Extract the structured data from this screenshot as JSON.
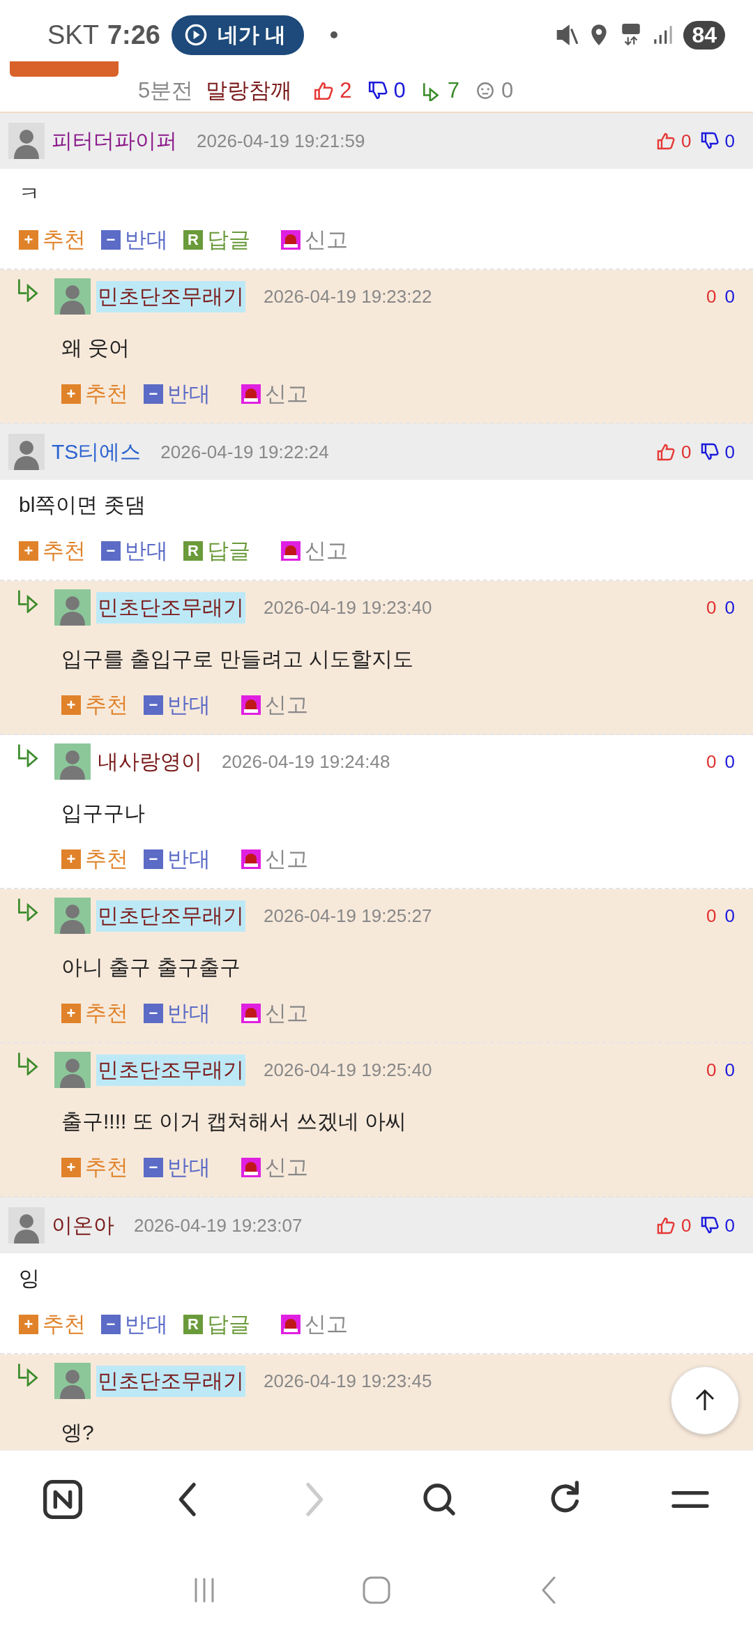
{
  "status_bar": {
    "carrier": "SKT",
    "time": "7:26",
    "media": "네가 내",
    "battery": "84"
  },
  "post_meta": {
    "ago": "5분전",
    "author": "말랑참깨",
    "likes": "2",
    "dislikes": "0",
    "replies": "7",
    "reactions": "0"
  },
  "comments": [
    {
      "kind": "comment",
      "name": "피터더파이퍼",
      "color": "#8b1a8b",
      "op": false,
      "highlighted": false,
      "time": "2026-04-19 19:21:59",
      "likes": "0",
      "dislikes": "0",
      "text": "ㅋ",
      "actions": [
        {
          "kind": "up",
          "label": "추천",
          "badge": "+"
        },
        {
          "kind": "down",
          "label": "반대",
          "badge": "−"
        },
        {
          "kind": "reply",
          "label": "답글",
          "badge": "R"
        },
        {
          "kind": "report",
          "label": "신고"
        }
      ]
    },
    {
      "kind": "reply",
      "name": "민초단조무래기",
      "color": "#7a1a1a",
      "op": true,
      "highlighted": true,
      "time": "2026-04-19 19:23:22",
      "likes": "0",
      "dislikes": "0",
      "text": "왜 웃어",
      "actions": [
        {
          "kind": "up",
          "label": "추천",
          "badge": "+"
        },
        {
          "kind": "down",
          "label": "반대",
          "badge": "−"
        },
        {
          "kind": "report",
          "label": "신고"
        }
      ]
    },
    {
      "kind": "comment",
      "name": "TS티에스",
      "color": "#2a62d0",
      "op": false,
      "highlighted": false,
      "time": "2026-04-19 19:22:24",
      "likes": "0",
      "dislikes": "0",
      "text": "bl쪽이면 좃댐",
      "actions": [
        {
          "kind": "up",
          "label": "추천",
          "badge": "+"
        },
        {
          "kind": "down",
          "label": "반대",
          "badge": "−"
        },
        {
          "kind": "reply",
          "label": "답글",
          "badge": "R"
        },
        {
          "kind": "report",
          "label": "신고"
        }
      ]
    },
    {
      "kind": "reply",
      "name": "민초단조무래기",
      "color": "#7a1a1a",
      "op": true,
      "highlighted": true,
      "time": "2026-04-19 19:23:40",
      "likes": "0",
      "dislikes": "0",
      "text": "입구를 출입구로 만들려고 시도할지도",
      "actions": [
        {
          "kind": "up",
          "label": "추천",
          "badge": "+"
        },
        {
          "kind": "down",
          "label": "반대",
          "badge": "−"
        },
        {
          "kind": "report",
          "label": "신고"
        }
      ]
    },
    {
      "kind": "reply",
      "name": "내사랑영이",
      "color": "#7a1a1a",
      "op": false,
      "highlighted": false,
      "time": "2026-04-19 19:24:48",
      "likes": "0",
      "dislikes": "0",
      "text": "입구구나",
      "actions": [
        {
          "kind": "up",
          "label": "추천",
          "badge": "+"
        },
        {
          "kind": "down",
          "label": "반대",
          "badge": "−"
        },
        {
          "kind": "report",
          "label": "신고"
        }
      ]
    },
    {
      "kind": "reply",
      "name": "민초단조무래기",
      "color": "#7a1a1a",
      "op": true,
      "highlighted": true,
      "time": "2026-04-19 19:25:27",
      "likes": "0",
      "dislikes": "0",
      "text": "아니 출구 출구출구",
      "actions": [
        {
          "kind": "up",
          "label": "추천",
          "badge": "+"
        },
        {
          "kind": "down",
          "label": "반대",
          "badge": "−"
        },
        {
          "kind": "report",
          "label": "신고"
        }
      ]
    },
    {
      "kind": "reply",
      "name": "민초단조무래기",
      "color": "#7a1a1a",
      "op": true,
      "highlighted": true,
      "time": "2026-04-19 19:25:40",
      "likes": "0",
      "dislikes": "0",
      "text": "출구!!!! 또 이거 캡쳐해서 쓰겠네 아씨",
      "actions": [
        {
          "kind": "up",
          "label": "추천",
          "badge": "+"
        },
        {
          "kind": "down",
          "label": "반대",
          "badge": "−"
        },
        {
          "kind": "report",
          "label": "신고"
        }
      ]
    },
    {
      "kind": "comment",
      "name": "이온아",
      "color": "#7a1a1a",
      "op": false,
      "highlighted": false,
      "time": "2026-04-19 19:23:07",
      "likes": "0",
      "dislikes": "0",
      "text": "잉",
      "actions": [
        {
          "kind": "up",
          "label": "추천",
          "badge": "+"
        },
        {
          "kind": "down",
          "label": "반대",
          "badge": "−"
        },
        {
          "kind": "reply",
          "label": "답글",
          "badge": "R"
        },
        {
          "kind": "report",
          "label": "신고"
        }
      ]
    },
    {
      "kind": "reply",
      "name": "민초단조무래기",
      "color": "#7a1a1a",
      "op": true,
      "highlighted": true,
      "time": "2026-04-19 19:23:45",
      "text": "엥?"
    }
  ]
}
